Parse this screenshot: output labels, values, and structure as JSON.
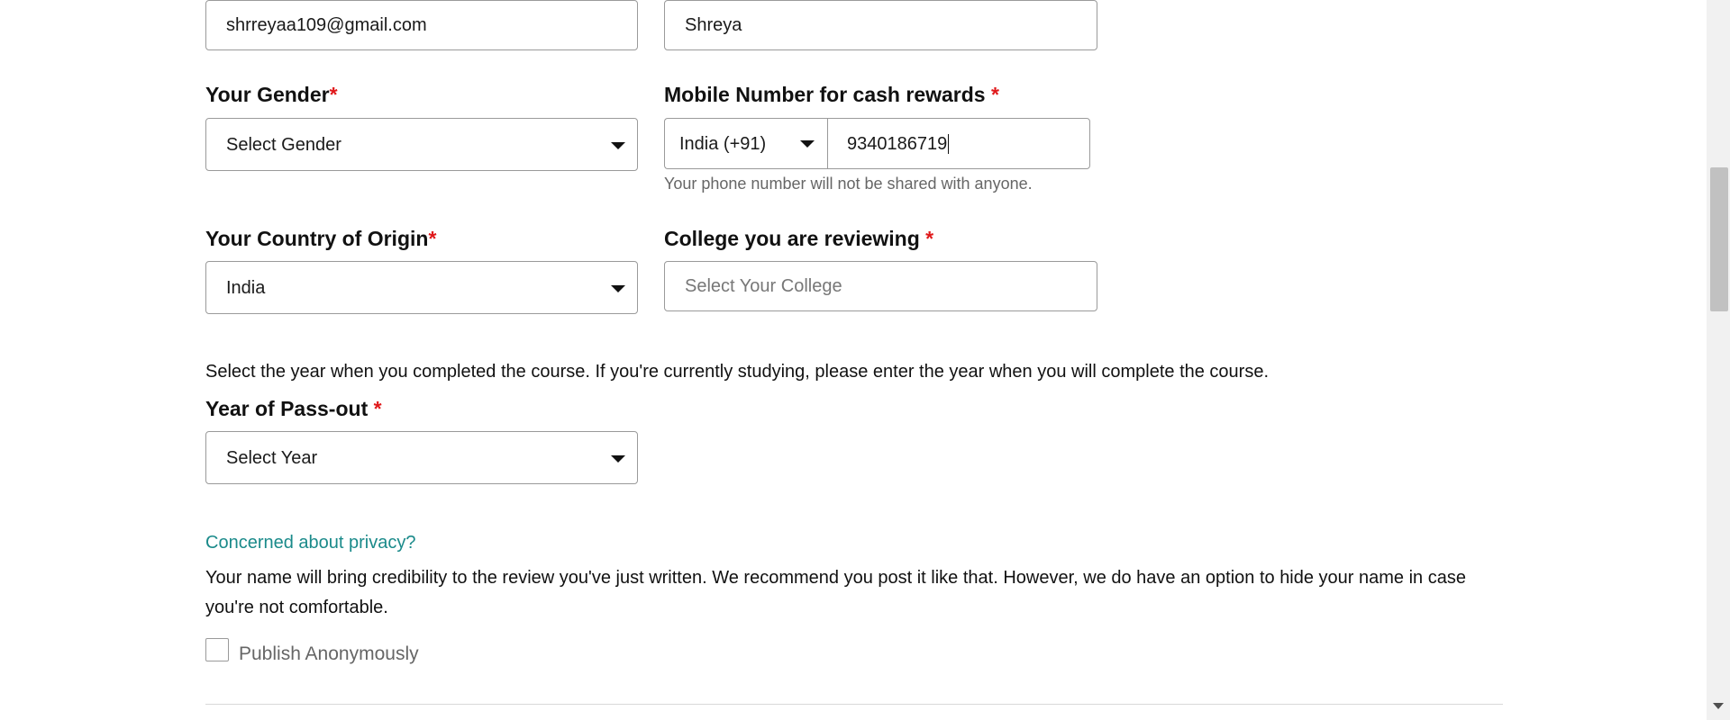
{
  "form": {
    "email": {
      "value": "shrreyaa109@gmail.com"
    },
    "name": {
      "value": "Shreya"
    },
    "gender": {
      "label": "Your Gender",
      "required_mark": "*",
      "selected": "Select Gender"
    },
    "mobile": {
      "label": "Mobile Number for cash rewards",
      "required_mark": "*",
      "country_code": "India (+91)",
      "value": "9340186719",
      "helper": "Your phone number will not be shared with anyone."
    },
    "country": {
      "label": "Your Country of Origin",
      "required_mark": "*",
      "selected": "India"
    },
    "college": {
      "label": "College you are reviewing",
      "required_mark": "*",
      "placeholder": "Select Your College"
    },
    "year_note": "Select the year when you completed the course. If you're currently studying, please enter the year when you will complete the course.",
    "year": {
      "label": "Year of Pass-out",
      "required_mark": "*",
      "selected": "Select Year"
    },
    "privacy": {
      "link": "Concerned about privacy?",
      "text": "Your name will bring credibility to the review you've just written. We recommend you post it like that. However, we do have an option to hide your name in case you're not comfortable.",
      "checkbox_label": "Publish Anonymously",
      "checked": false
    }
  },
  "colors": {
    "required": "#e0191b",
    "link": "#1a8a8a",
    "border": "#9a9a9a"
  }
}
